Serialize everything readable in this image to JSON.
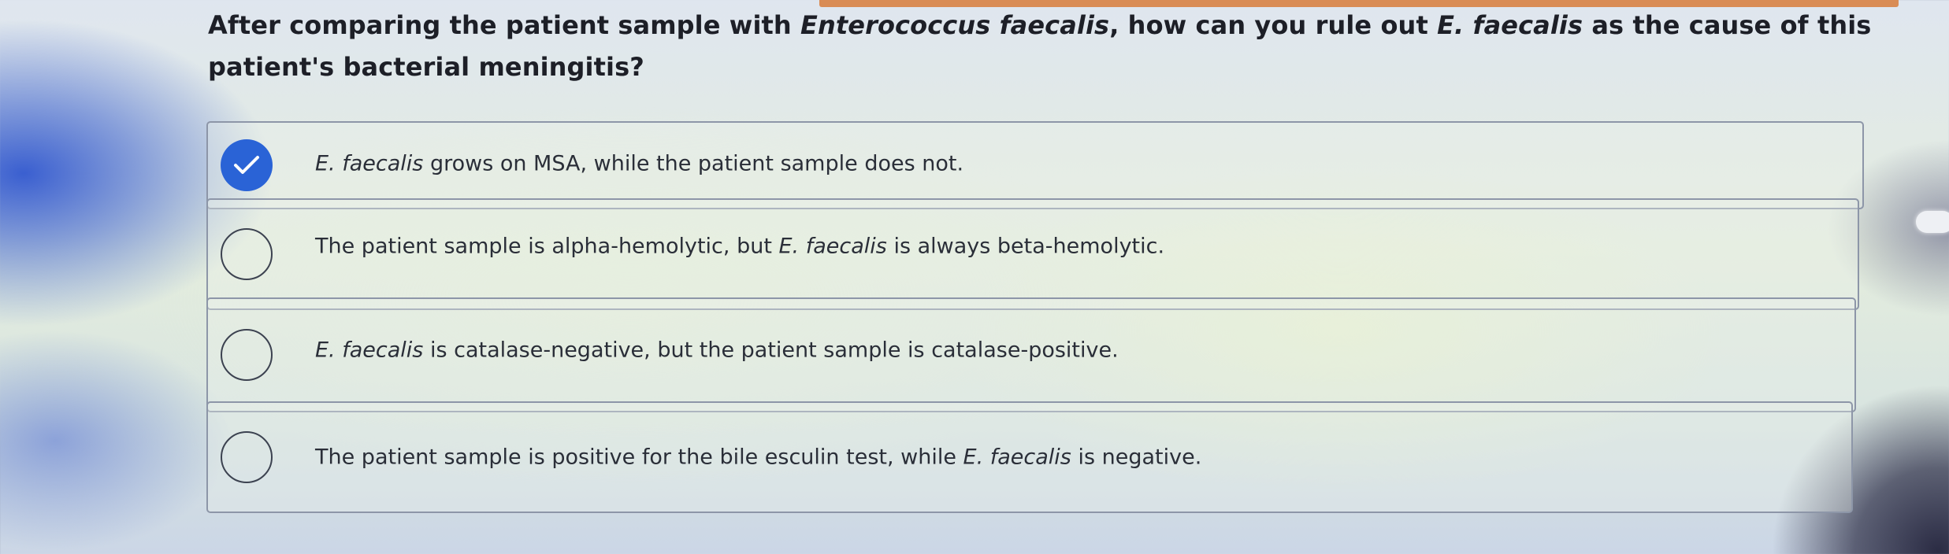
{
  "question": {
    "part1": "After comparing the patient sample with ",
    "organism": "Enterococcus faecalis",
    "part2": ", how can you rule out ",
    "abbrev": "E. faecalis",
    "part3": " as the cause of this patient's bacterial meningitis?"
  },
  "options": [
    {
      "selected": true,
      "italic": "E. faecalis",
      "text": " grows on MSA, while the patient sample does not."
    },
    {
      "selected": false,
      "before": "The patient sample is alpha-hemolytic, but ",
      "italic": "E. faecalis",
      "after": " is always beta-hemolytic."
    },
    {
      "selected": false,
      "italic": "E. faecalis",
      "text": " is catalase-negative, but the patient sample is catalase-positive."
    },
    {
      "selected": false,
      "before": "The patient sample is positive for the bile esculin test, while ",
      "italic": "E. faecalis",
      "after": " is negative."
    }
  ],
  "icons": {
    "selected": "checkmark-icon",
    "unselected": "radio-circle-icon"
  },
  "colors": {
    "selected_radio": "#2a63d6",
    "accent_bar": "#d98c55"
  }
}
